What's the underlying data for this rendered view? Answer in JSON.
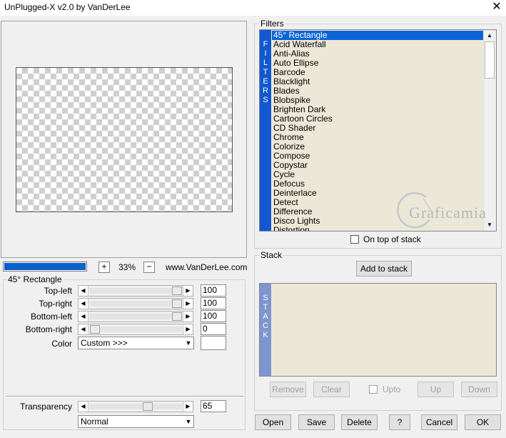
{
  "window": {
    "title": "UnPlugged-X v2.0 by VanDerLee",
    "close_glyph": "✕"
  },
  "preview": {
    "zoom": "33%",
    "zoom_plus": "+",
    "zoom_minus": "−",
    "site": "www.VanDerLee.com",
    "progress_percent": 100
  },
  "params": {
    "group_label": "45° Rectangle",
    "sliders": [
      {
        "label": "Top-left",
        "value": "100"
      },
      {
        "label": "Top-right",
        "value": "100"
      },
      {
        "label": "Bottom-left",
        "value": "100"
      },
      {
        "label": "Bottom-right",
        "value": "0"
      }
    ],
    "color_label": "Color",
    "color_value": "Custom >>>"
  },
  "transparency": {
    "label": "Transparency",
    "value": "65"
  },
  "blend_mode": "Normal",
  "filters": {
    "group_label": "Filters",
    "strip_letters": [
      "F",
      "I",
      "L",
      "T",
      "E",
      "R",
      "S"
    ],
    "selected_index": 0,
    "items": [
      "45° Rectangle",
      "Acid Waterfall",
      "Anti-Alias",
      "Auto Ellipse",
      "Barcode",
      "Blacklight",
      "Blades",
      "Blobspike",
      "Brighten Dark",
      "Cartoon Circles",
      "CD Shader",
      "Chrome",
      "Colorize",
      "Compose",
      "Copystar",
      "Cycle",
      "Defocus",
      "Deinterlace",
      "Detect",
      "Difference",
      "Disco Lights",
      "Distortion"
    ],
    "on_top_label": "On top of stack"
  },
  "stack": {
    "group_label": "Stack",
    "add_button": "Add to stack",
    "strip_letters": [
      "S",
      "T",
      "A",
      "C",
      "K"
    ],
    "remove": "Remove",
    "clear": "Clear",
    "upto": "Upto",
    "up": "Up",
    "down": "Down"
  },
  "footer": {
    "open": "Open",
    "save": "Save",
    "delete": "Delete",
    "help": "?",
    "cancel": "Cancel",
    "ok": "OK"
  },
  "watermark": "Graficamia",
  "colors": {
    "accent": "#0a64d6",
    "strip": "#1157cf",
    "stack_strip": "#7f95d0",
    "list_bg": "#ece8d8"
  }
}
